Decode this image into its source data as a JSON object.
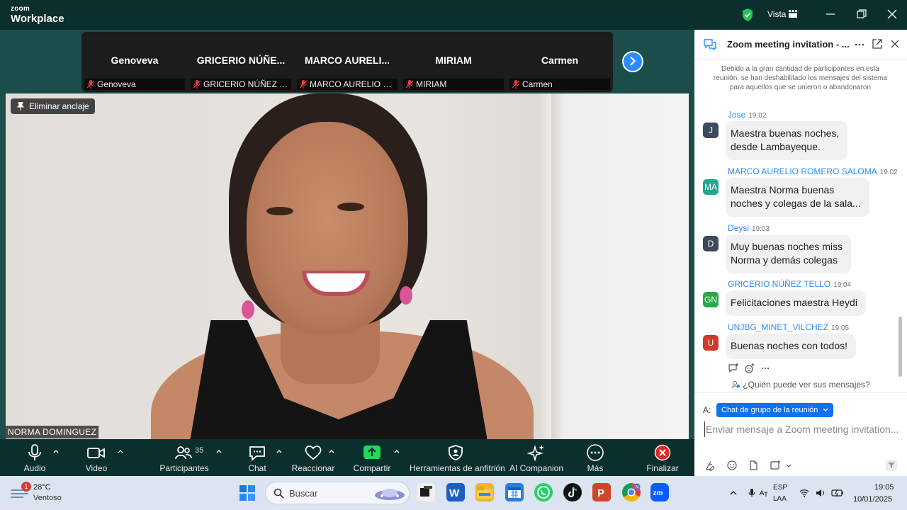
{
  "topbar": {
    "brand_top": "zoom",
    "brand_bottom": "Workplace",
    "view_label": "Vista"
  },
  "strip": {
    "tiles": [
      {
        "name": "Genoveva",
        "caption": "Genoveva"
      },
      {
        "name": "GRICERIO NÚÑE...",
        "caption": "GRICERIO NÚÑEZ TE..."
      },
      {
        "name": "MARCO AURELI...",
        "caption": "MARCO AURELIO RO..."
      },
      {
        "name": "MIRIAM",
        "caption": "MIRIAM"
      },
      {
        "name": "Carmen",
        "caption": "Carmen"
      }
    ]
  },
  "video": {
    "unpin_label": "Eliminar anclaje",
    "participant_name": "NORMA DOMINGUEZ"
  },
  "toolbar": {
    "audio": "Audio",
    "video": "Video",
    "participants": "Participantes",
    "participants_count": "35",
    "chat": "Chat",
    "react": "Reaccionar",
    "share": "Compartir",
    "host_tools": "Herramientas de anfitrión",
    "ai": "AI Companion",
    "more": "Más",
    "end": "Finalizar"
  },
  "chat": {
    "title": "Zoom meeting invitation - ...",
    "notice": "Debido a la gran cantidad de participantes en esta reunión, se han deshabilitado los mensajes del sistema para aquellos que se unieron o abandonaron",
    "messages": [
      {
        "initials": "J",
        "sender": "Jose",
        "time": "19:02",
        "text_1": "Maestra buenas noches,",
        "text_2": "desde Lambayeque.",
        "color": "#3b4a5c"
      },
      {
        "initials": "MA",
        "sender": "MARCO AURELIO ROMERO SALOMA",
        "time": "19:02",
        "text_1": "Maestra Norma buenas",
        "text_2": "noches y colegas de la sala...",
        "color": "#1fa890"
      },
      {
        "initials": "D",
        "sender": "Deysi",
        "time": "19:03",
        "text_1": "Muy buenas noches miss",
        "text_2": "Norma y demás colegas",
        "color": "#3b4a5c"
      },
      {
        "initials": "GN",
        "sender": "GRICERIO NÚÑEZ TELLO",
        "time": "19:04",
        "text_1": "Felicitaciones maestra Heydi",
        "text_2": "",
        "color": "#27a84a"
      },
      {
        "initials": "U",
        "sender": "UNJBG_MINET_VILCHEZ",
        "time": "19:05",
        "text_1": "Buenas noches con todos!",
        "text_2": "",
        "color": "#d0382c"
      }
    ],
    "who_can_see": "¿Quién puede ver sus mensajes?",
    "to_label": "A:",
    "to_value": "Chat de grupo de la reunión",
    "input_placeholder": "Enviar mensaje a Zoom meeting invitation..."
  },
  "taskbar": {
    "weather_badge": "1",
    "temperature": "28°C",
    "weather": "Ventoso",
    "search_placeholder": "Buscar",
    "lang_1": "ESP",
    "lang_2": "LAA",
    "time": "19:05",
    "date": "10/01/2025"
  },
  "colors": {
    "stage": "#1b4d4a",
    "topbar": "#0b2f2d",
    "accent": "#2d8cff",
    "share": "#23d959",
    "end": "#e02828"
  }
}
